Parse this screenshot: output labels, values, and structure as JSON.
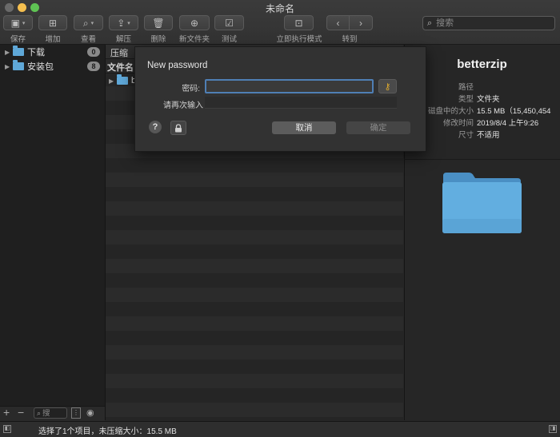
{
  "window": {
    "title": "未命名"
  },
  "toolbar": {
    "save": "保存",
    "add": "增加",
    "view": "查看",
    "extract": "解压",
    "delete": "删除",
    "new_folder": "新文件夹",
    "test": "测试",
    "exec_mode": "立即执行模式",
    "goto": "转到",
    "search_placeholder": "搜索"
  },
  "sidebar": {
    "items": [
      {
        "label": "下载",
        "count": "0"
      },
      {
        "label": "安装包",
        "count": "8"
      }
    ],
    "search_placeholder": "搜"
  },
  "filelist": {
    "header_compress": "压缩",
    "header_filename": "文件名",
    "first_entry_partial": "b"
  },
  "info": {
    "name": "betterzip",
    "rows": [
      {
        "key": "路径",
        "value": ""
      },
      {
        "key": "类型",
        "value": "文件夹"
      },
      {
        "key": "磁盘中的大小",
        "value": "15.5 MB（15,450,454"
      },
      {
        "key": "修改时间",
        "value": "2019/8/4 上午9:26"
      },
      {
        "key": "尺寸",
        "value": "不适用"
      }
    ]
  },
  "dialog": {
    "title": "New password",
    "password_label": "密码:",
    "repeat_label": "请再次输入",
    "password_value": "",
    "repeat_value": "",
    "help": "?",
    "cancel": "取消",
    "ok": "确定"
  },
  "status": {
    "text": "选择了1个项目，未压缩大小：15.5 MB"
  },
  "colors": {
    "accent": "#4f7fb5",
    "folder": "#5fa8d8",
    "key": "#d9a72f"
  }
}
